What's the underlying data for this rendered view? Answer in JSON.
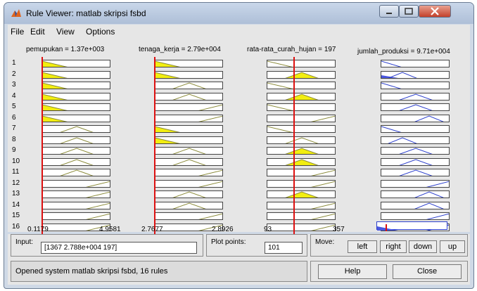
{
  "window": {
    "title": "Rule Viewer: matlab skripsi fsbd",
    "menu": [
      "File",
      "Edit",
      "View",
      "Options"
    ]
  },
  "inputs": [
    {
      "name": "pemupukan",
      "value": "1.37e+003",
      "range": [
        "0.1179",
        "4.9581"
      ],
      "crosshair": 0.0,
      "mfs": [
        "low",
        "mid",
        "high"
      ]
    },
    {
      "name": "tenaga_kerja",
      "value": "2.79e+004",
      "range": [
        "2.7677",
        "2.8926"
      ],
      "crosshair": 0.0,
      "mfs": [
        "low",
        "mid",
        "high"
      ]
    },
    {
      "name": "rata-rata_curah_hujan",
      "value": "197",
      "range": [
        "93",
        "357"
      ],
      "crosshair": 0.39,
      "mfs": [
        "low",
        "mid",
        "high"
      ]
    }
  ],
  "output": {
    "name": "jumlah_produksi",
    "value": "9.71e+004",
    "mfs": [
      "vlow",
      "low",
      "mid",
      "high",
      "vhigh"
    ]
  },
  "rules": [
    {
      "n": "1",
      "a": [
        "low",
        "low",
        "low"
      ],
      "o": "vlow"
    },
    {
      "n": "2",
      "a": [
        "low",
        "low",
        "mid"
      ],
      "o": "low"
    },
    {
      "n": "3",
      "a": [
        "low",
        "mid",
        "low"
      ],
      "o": "vlow"
    },
    {
      "n": "4",
      "a": [
        "low",
        "mid",
        "mid"
      ],
      "o": "mid"
    },
    {
      "n": "5",
      "a": [
        "low",
        "high",
        "low"
      ],
      "o": "mid"
    },
    {
      "n": "6",
      "a": [
        "low",
        "high",
        "high"
      ],
      "o": "high"
    },
    {
      "n": "7",
      "a": [
        "mid",
        "low",
        "low"
      ],
      "o": "vlow"
    },
    {
      "n": "8",
      "a": [
        "mid",
        "low",
        "mid"
      ],
      "o": "low"
    },
    {
      "n": "9",
      "a": [
        "mid",
        "mid",
        "mid"
      ],
      "o": "mid"
    },
    {
      "n": "10",
      "a": [
        "mid",
        "mid",
        "mid"
      ],
      "o": "mid"
    },
    {
      "n": "11",
      "a": [
        "mid",
        "high",
        "high"
      ],
      "o": "mid"
    },
    {
      "n": "12",
      "a": [
        "high",
        "high",
        "high"
      ],
      "o": "vhigh"
    },
    {
      "n": "13",
      "a": [
        "high",
        "mid",
        "mid"
      ],
      "o": "high"
    },
    {
      "n": "14",
      "a": [
        "high",
        "mid",
        "high"
      ],
      "o": "high"
    },
    {
      "n": "15",
      "a": [
        "high",
        "high",
        "high"
      ],
      "o": "vhigh"
    },
    {
      "n": "16",
      "a": [
        "high",
        "high",
        "high"
      ],
      "o": "vhigh"
    }
  ],
  "bottom": {
    "input_label": "Input:",
    "input_value": "[1367 2.788e+004 197]",
    "plot_points_label": "Plot points:",
    "plot_points_value": "101",
    "move_label": "Move:",
    "move_buttons": [
      "left",
      "right",
      "down",
      "up"
    ],
    "status": "Opened system matlab skripsi fsbd, 16 rules",
    "help_label": "Help",
    "close_label": "Close"
  },
  "colors": {
    "fired": "#f2ee10",
    "output_fired": "#4a57e0",
    "crosshair": "#dd1010",
    "input_mf": "#8b8b3a",
    "output_mf": "#2b3ecc"
  }
}
